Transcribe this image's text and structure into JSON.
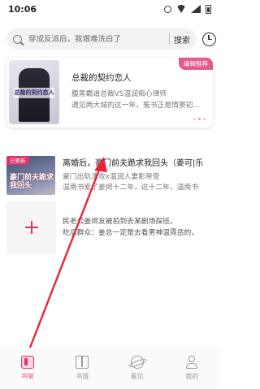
{
  "status_bar": {
    "time": "10:06"
  },
  "search": {
    "placeholder": "穿成反派后，我艰难洗白了",
    "button_label": "搜索"
  },
  "recommendation": {
    "badge": "编辑推荐",
    "cover_text": "总裁的契约恋人",
    "title": "总裁的契约恋人",
    "desc_lines": [
      "腹黑霸道总裁VS温润痴心律师",
      "遇见两大城的这一年，冤书正是情窦初..."
    ]
  },
  "shelf": {
    "items": [
      {
        "badge": "已更新",
        "cover_text": "豪门前夫跪求我回头",
        "title": "离婚后，豪门前夫跪求我回头（姜可|乐",
        "desc_lines": [
          "豪门出轨渣攻x温润人妻影帝受",
          "温南书爱了姜烬十二年，这十二年，温南书"
        ]
      }
    ],
    "add_label": "添加书籍",
    "notice_lines": [
      "民老公姜烬友被拍到去某剧场探班。",
      "吃瓜群众：姜总一定是去看男神温霓岳的，"
    ]
  },
  "tabs": [
    {
      "label": "书架",
      "icon": "bookshelf-icon",
      "active": true
    },
    {
      "label": "书城",
      "icon": "book-icon",
      "active": false
    },
    {
      "label": "看见",
      "icon": "planet-icon",
      "active": false
    },
    {
      "label": "我的",
      "icon": "user-icon",
      "active": false
    }
  ],
  "colors": {
    "accent": "#e25b8c",
    "arrow": "#e8243a"
  }
}
